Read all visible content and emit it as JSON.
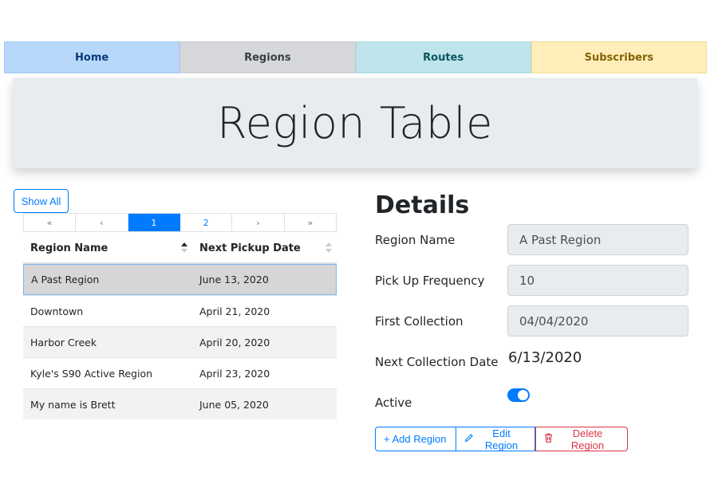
{
  "nav": {
    "home": "Home",
    "regions": "Regions",
    "routes": "Routes",
    "subscribers": "Subscribers"
  },
  "header": {
    "title": "Region Table"
  },
  "left": {
    "show_all": "Show All",
    "pager": [
      "«",
      "‹",
      "1",
      "2",
      "›",
      "»"
    ],
    "table": {
      "columns": [
        "Region Name",
        "Next Pickup Date"
      ],
      "rows": [
        [
          "A Past Region",
          "June 13, 2020"
        ],
        [
          "Downtown",
          "April 21, 2020"
        ],
        [
          "Harbor Creek",
          "April 20, 2020"
        ],
        [
          "Kyle's S90 Active Region",
          "April 23, 2020"
        ],
        [
          "My name is Brett",
          "June 05, 2020"
        ]
      ]
    }
  },
  "details": {
    "title": "Details",
    "region_name_label": "Region Name",
    "region_name_value": "A Past Region",
    "frequency_label": "Pick Up Frequency",
    "frequency_value": "10",
    "first_collection_label": "First Collection",
    "first_collection_value": "04/04/2020",
    "next_collection_label": "Next Collection Date",
    "next_collection_value": "6/13/2020",
    "active_label": "Active",
    "active": true,
    "add_button": "+ Add Region",
    "edit_button": "Edit Region",
    "delete_button": "Delete Region"
  },
  "icons": {
    "edit": "pencil-icon",
    "delete": "trash-icon"
  },
  "colors": {
    "primary": "#007bff",
    "danger": "#dc3545"
  }
}
